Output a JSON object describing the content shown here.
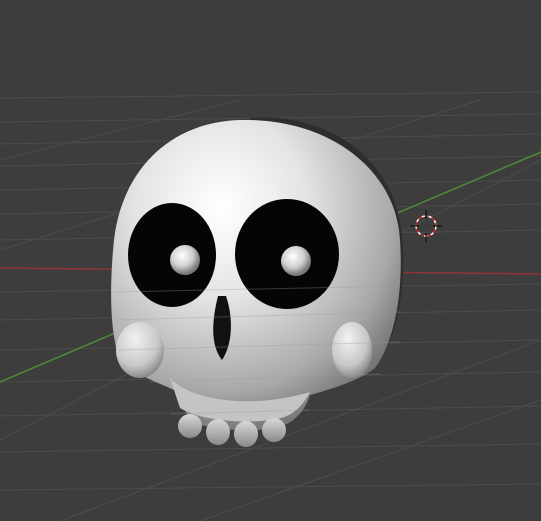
{
  "viewport": {
    "background": "#3d3d3d",
    "grid_color": "#4a4a4a",
    "x_axis_color": "#b4363a",
    "y_axis_color": "#5c9a3c",
    "cursor_colors": [
      "#ffffff",
      "#cc2a2a"
    ]
  },
  "object": {
    "kind": "skull-mesh",
    "material_color": "#e8e8e8"
  }
}
